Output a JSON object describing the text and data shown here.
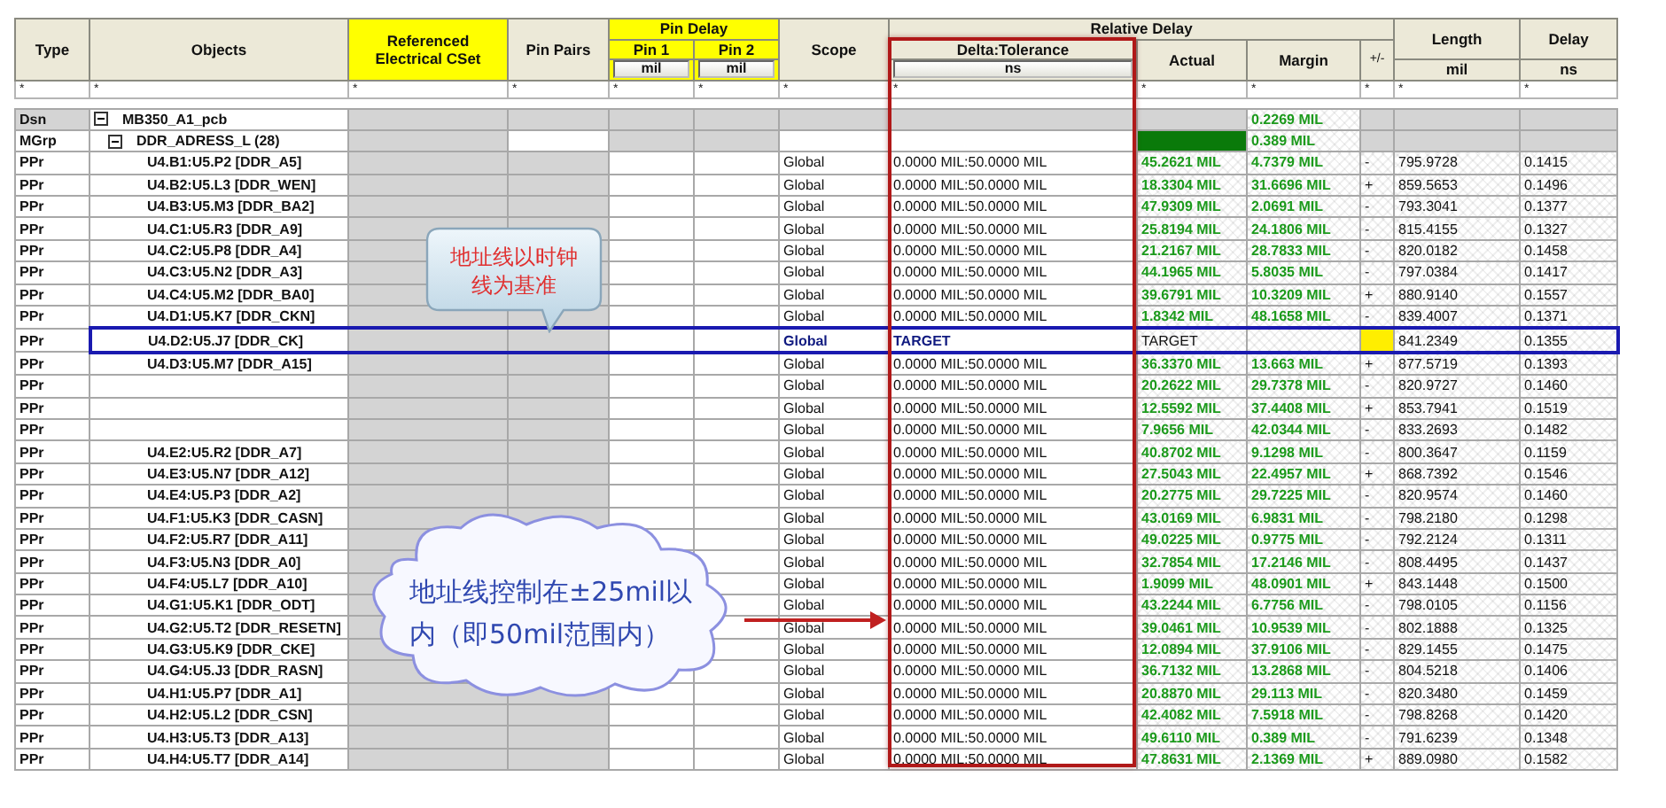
{
  "header": {
    "type": "Type",
    "objects": "Objects",
    "cset": "Referenced Electrical CSet",
    "pin_pairs": "Pin Pairs",
    "pin_delay": "Pin Delay",
    "pin1": "Pin 1",
    "pin2": "Pin 2",
    "pin1_unit": "mil",
    "pin2_unit": "mil",
    "scope": "Scope",
    "relative_delay": "Relative Delay",
    "delta": "Delta:Tolerance",
    "delta_unit": "ns",
    "actual": "Actual",
    "margin": "Margin",
    "sign": "+/-",
    "length": "Length",
    "length_unit": "mil",
    "delay": "Delay",
    "delay_unit": "ns"
  },
  "filters": [
    "*",
    "*",
    "*",
    "*",
    "*",
    "*",
    "*",
    "*",
    "*",
    "*",
    "*",
    "*",
    "*"
  ],
  "rows": [
    {
      "kind": "design",
      "type": "Dsn",
      "object": "MB350_A1_pcb",
      "expanded": true,
      "margin": "0.2269 MIL"
    },
    {
      "kind": "group",
      "type": "MGrp",
      "object": "DDR_ADRESS_L (28)",
      "expanded": true,
      "actual_fill": true,
      "margin": "0.389 MIL"
    },
    {
      "kind": "pin_pair",
      "type": "PPr",
      "object": "U4.B1:U5.P2 [DDR_A5]",
      "scope": "Global",
      "delta": "0.0000 MIL:50.0000 MIL",
      "actual": "45.2621 MIL",
      "margin": "4.7379 MIL",
      "sign": "-",
      "length": "795.9728",
      "delay": "0.1415",
      "target": false,
      "framed": false
    },
    {
      "kind": "pin_pair",
      "type": "PPr",
      "object": "U4.B2:U5.L3 [DDR_WEN]",
      "scope": "Global",
      "delta": "0.0000 MIL:50.0000 MIL",
      "actual": "18.3304 MIL",
      "margin": "31.6696 MIL",
      "sign": "+",
      "length": "859.5653",
      "delay": "0.1496",
      "target": false,
      "framed": false
    },
    {
      "kind": "pin_pair",
      "type": "PPr",
      "object": "U4.B3:U5.M3 [DDR_BA2]",
      "scope": "Global",
      "delta": "0.0000 MIL:50.0000 MIL",
      "actual": "47.9309 MIL",
      "margin": "2.0691 MIL",
      "sign": "-",
      "length": "793.3041",
      "delay": "0.1377",
      "target": false,
      "framed": false
    },
    {
      "kind": "pin_pair",
      "type": "PPr",
      "object": "U4.C1:U5.R3 [DDR_A9]",
      "scope": "Global",
      "delta": "0.0000 MIL:50.0000 MIL",
      "actual": "25.8194 MIL",
      "margin": "24.1806 MIL",
      "sign": "-",
      "length": "815.4155",
      "delay": "0.1327",
      "target": false,
      "framed": false
    },
    {
      "kind": "pin_pair",
      "type": "PPr",
      "object": "U4.C2:U5.P8 [DDR_A4]",
      "scope": "Global",
      "delta": "0.0000 MIL:50.0000 MIL",
      "actual": "21.2167 MIL",
      "margin": "28.7833 MIL",
      "sign": "-",
      "length": "820.0182",
      "delay": "0.1458",
      "target": false,
      "framed": false
    },
    {
      "kind": "pin_pair",
      "type": "PPr",
      "object": "U4.C3:U5.N2 [DDR_A3]",
      "scope": "Global",
      "delta": "0.0000 MIL:50.0000 MIL",
      "actual": "44.1965 MIL",
      "margin": "5.8035 MIL",
      "sign": "-",
      "length": "797.0384",
      "delay": "0.1417",
      "target": false,
      "framed": false
    },
    {
      "kind": "pin_pair",
      "type": "PPr",
      "object": "U4.C4:U5.M2 [DDR_BA0]",
      "scope": "Global",
      "delta": "0.0000 MIL:50.0000 MIL",
      "actual": "39.6791 MIL",
      "margin": "10.3209 MIL",
      "sign": "+",
      "length": "880.9140",
      "delay": "0.1557",
      "target": false,
      "framed": false
    },
    {
      "kind": "pin_pair",
      "type": "PPr",
      "object": "U4.D1:U5.K7 [DDR_CKN]",
      "scope": "Global",
      "delta": "0.0000 MIL:50.0000 MIL",
      "actual": "1.8342 MIL",
      "margin": "48.1658 MIL",
      "sign": "-",
      "length": "839.4007",
      "delay": "0.1371",
      "target": false,
      "framed": false
    },
    {
      "kind": "pin_pair",
      "type": "PPr",
      "object": "U4.D2:U5.J7 [DDR_CK]",
      "scope": "Global",
      "delta": "TARGET",
      "actual": "TARGET",
      "length": "841.2349",
      "delay": "0.1355",
      "target": true,
      "framed": true
    },
    {
      "kind": "pin_pair",
      "type": "PPr",
      "object": "U4.D3:U5.M7 [DDR_A15]",
      "scope": "Global",
      "delta": "0.0000 MIL:50.0000 MIL",
      "actual": "36.3370 MIL",
      "margin": "13.663 MIL",
      "sign": "+",
      "length": "877.5719",
      "delay": "0.1393",
      "target": false,
      "framed": false
    },
    {
      "kind": "pin_pair",
      "type": "PPr",
      "scope": "Global",
      "delta": "0.0000 MIL:50.0000 MIL",
      "actual": "20.2622 MIL",
      "margin": "29.7378 MIL",
      "sign": "-",
      "length": "820.9727",
      "delay": "0.1460",
      "target": false,
      "framed": false
    },
    {
      "kind": "pin_pair",
      "type": "PPr",
      "scope": "Global",
      "delta": "0.0000 MIL:50.0000 MIL",
      "actual": "12.5592 MIL",
      "margin": "37.4408 MIL",
      "sign": "+",
      "length": "853.7941",
      "delay": "0.1519",
      "target": false,
      "framed": false
    },
    {
      "kind": "pin_pair",
      "type": "PPr",
      "scope": "Global",
      "delta": "0.0000 MIL:50.0000 MIL",
      "actual": "7.9656 MIL",
      "margin": "42.0344 MIL",
      "sign": "-",
      "length": "833.2693",
      "delay": "0.1482",
      "target": false,
      "framed": false
    },
    {
      "kind": "pin_pair",
      "type": "PPr",
      "object": "U4.E2:U5.R2 [DDR_A7]",
      "scope": "Global",
      "delta": "0.0000 MIL:50.0000 MIL",
      "actual": "40.8702 MIL",
      "margin": "9.1298 MIL",
      "sign": "-",
      "length": "800.3647",
      "delay": "0.1159",
      "target": false,
      "framed": false
    },
    {
      "kind": "pin_pair",
      "type": "PPr",
      "object": "U4.E3:U5.N7 [DDR_A12]",
      "scope": "Global",
      "delta": "0.0000 MIL:50.0000 MIL",
      "actual": "27.5043 MIL",
      "margin": "22.4957 MIL",
      "sign": "+",
      "length": "868.7392",
      "delay": "0.1546",
      "target": false,
      "framed": false
    },
    {
      "kind": "pin_pair",
      "type": "PPr",
      "object": "U4.E4:U5.P3 [DDR_A2]",
      "scope": "Global",
      "delta": "0.0000 MIL:50.0000 MIL",
      "actual": "20.2775 MIL",
      "margin": "29.7225 MIL",
      "sign": "-",
      "length": "820.9574",
      "delay": "0.1460",
      "target": false,
      "framed": false
    },
    {
      "kind": "pin_pair",
      "type": "PPr",
      "object": "U4.F1:U5.K3 [DDR_CASN]",
      "scope": "Global",
      "delta": "0.0000 MIL:50.0000 MIL",
      "actual": "43.0169 MIL",
      "margin": "6.9831 MIL",
      "sign": "-",
      "length": "798.2180",
      "delay": "0.1298",
      "target": false,
      "framed": false
    },
    {
      "kind": "pin_pair",
      "type": "PPr",
      "object": "U4.F2:U5.R7 [DDR_A11]",
      "scope": "Global",
      "delta": "0.0000 MIL:50.0000 MIL",
      "actual": "49.0225 MIL",
      "margin": "0.9775 MIL",
      "sign": "-",
      "length": "792.2124",
      "delay": "0.1311",
      "target": false,
      "framed": false
    },
    {
      "kind": "pin_pair",
      "type": "PPr",
      "object": "U4.F3:U5.N3 [DDR_A0]",
      "scope": "Global",
      "delta": "0.0000 MIL:50.0000 MIL",
      "actual": "32.7854 MIL",
      "margin": "17.2146 MIL",
      "sign": "-",
      "length": "808.4495",
      "delay": "0.1437",
      "target": false,
      "framed": false
    },
    {
      "kind": "pin_pair",
      "type": "PPr",
      "object": "U4.F4:U5.L7 [DDR_A10]",
      "scope": "Global",
      "delta": "0.0000 MIL:50.0000 MIL",
      "actual": "1.9099 MIL",
      "margin": "48.0901 MIL",
      "sign": "+",
      "length": "843.1448",
      "delay": "0.1500",
      "target": false,
      "framed": false
    },
    {
      "kind": "pin_pair",
      "type": "PPr",
      "object": "U4.G1:U5.K1 [DDR_ODT]",
      "scope": "Global",
      "delta": "0.0000 MIL:50.0000 MIL",
      "actual": "43.2244 MIL",
      "margin": "6.7756 MIL",
      "sign": "-",
      "length": "798.0105",
      "delay": "0.1156",
      "target": false,
      "framed": false
    },
    {
      "kind": "pin_pair",
      "type": "PPr",
      "object": "U4.G2:U5.T2 [DDR_RESETN]",
      "scope": "Global",
      "delta": "0.0000 MIL:50.0000 MIL",
      "actual": "39.0461 MIL",
      "margin": "10.9539 MIL",
      "sign": "-",
      "length": "802.1888",
      "delay": "0.1325",
      "target": false,
      "framed": false
    },
    {
      "kind": "pin_pair",
      "type": "PPr",
      "object": "U4.G3:U5.K9 [DDR_CKE]",
      "scope": "Global",
      "delta": "0.0000 MIL:50.0000 MIL",
      "actual": "12.0894 MIL",
      "margin": "37.9106 MIL",
      "sign": "-",
      "length": "829.1455",
      "delay": "0.1475",
      "target": false,
      "framed": false
    },
    {
      "kind": "pin_pair",
      "type": "PPr",
      "object": "U4.G4:U5.J3 [DDR_RASN]",
      "scope": "Global",
      "delta": "0.0000 MIL:50.0000 MIL",
      "actual": "36.7132 MIL",
      "margin": "13.2868 MIL",
      "sign": "-",
      "length": "804.5218",
      "delay": "0.1406",
      "target": false,
      "framed": false
    },
    {
      "kind": "pin_pair",
      "type": "PPr",
      "object": "U4.H1:U5.P7 [DDR_A1]",
      "scope": "Global",
      "delta": "0.0000 MIL:50.0000 MIL",
      "actual": "20.8870 MIL",
      "margin": "29.113 MIL",
      "sign": "-",
      "length": "820.3480",
      "delay": "0.1459",
      "target": false,
      "framed": false
    },
    {
      "kind": "pin_pair",
      "type": "PPr",
      "object": "U4.H2:U5.L2 [DDR_CSN]",
      "scope": "Global",
      "delta": "0.0000 MIL:50.0000 MIL",
      "actual": "42.4082 MIL",
      "margin": "7.5918 MIL",
      "sign": "-",
      "length": "798.8268",
      "delay": "0.1420",
      "target": false,
      "framed": false
    },
    {
      "kind": "pin_pair",
      "type": "PPr",
      "object": "U4.H3:U5.T3 [DDR_A13]",
      "scope": "Global",
      "delta": "0.0000 MIL:50.0000 MIL",
      "actual": "49.6110 MIL",
      "margin": "0.389 MIL",
      "sign": "-",
      "length": "791.6239",
      "delay": "0.1348",
      "target": false,
      "framed": false
    },
    {
      "kind": "pin_pair",
      "type": "PPr",
      "object": "U4.H4:U5.T7 [DDR_A14]",
      "scope": "Global",
      "delta": "0.0000 MIL:50.0000 MIL",
      "actual": "47.8631 MIL",
      "margin": "2.1369 MIL",
      "sign": "+",
      "length": "889.0980",
      "delay": "0.1582",
      "target": false,
      "framed": false
    }
  ],
  "annotations": {
    "callout": "地址线以时钟线为基准",
    "cloud": "地址线控制在±25mil以内（即50mil范围内）"
  }
}
